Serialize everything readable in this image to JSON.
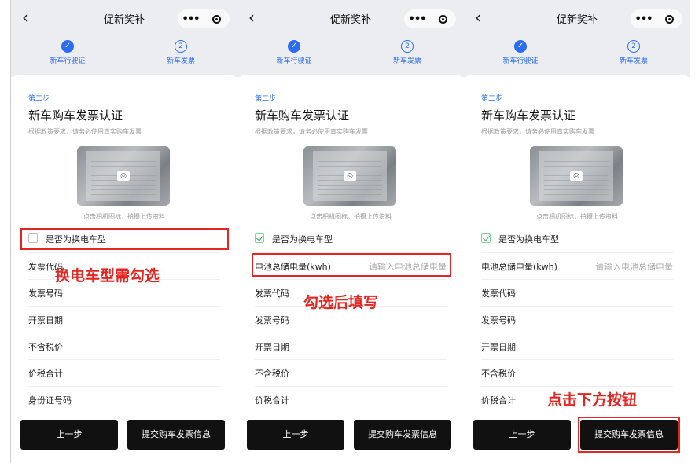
{
  "panels": [
    {
      "back_icon": "‹",
      "title": "促新奖补",
      "more_icon": "•••",
      "steps": {
        "step1_check": "✓",
        "step1_label": "新车行驶证",
        "step2_num": "2",
        "step2_label": "新车发票"
      },
      "step_tag": "第二步",
      "card_title": "新车购车发票认证",
      "card_desc": "根据政策要求，请务必使用真实购车发票",
      "photo_hint": "点击相机图标，拍摄上传资料",
      "checkbox_label": "是否为换电车型",
      "fields": [
        "发票代码",
        "发票号码",
        "开票日期",
        "不含税价",
        "价税合计",
        "身份证号码"
      ],
      "btn_prev": "上一步",
      "btn_submit": "提交购车发票信息",
      "annotation": "换电车型需勾选"
    },
    {
      "back_icon": "‹",
      "title": "促新奖补",
      "more_icon": "•••",
      "steps": {
        "step1_check": "✓",
        "step1_label": "新车行驶证",
        "step2_num": "2",
        "step2_label": "新车发票"
      },
      "step_tag": "第二步",
      "card_title": "新车购车发票认证",
      "card_desc": "根据政策要求，请务必使用真实购车发票",
      "photo_hint": "点击相机图标，拍摄上传资料",
      "checkbox_label": "是否为换电车型",
      "battery_label": "电池总储电量(kwh)",
      "battery_placeholder": "请输入电池总储电量",
      "fields": [
        "发票代码",
        "发票号码",
        "开票日期",
        "不含税价",
        "价税合计"
      ],
      "btn_prev": "上一步",
      "btn_submit": "提交购车发票信息",
      "annotation": "勾选后填写"
    },
    {
      "back_icon": "‹",
      "title": "促新奖补",
      "more_icon": "•••",
      "steps": {
        "step1_check": "✓",
        "step1_label": "新车行驶证",
        "step2_num": "2",
        "step2_label": "新车发票"
      },
      "step_tag": "第二步",
      "card_title": "新车购车发票认证",
      "card_desc": "根据政策要求，请务必使用真实购车发票",
      "photo_hint": "点击相机图标，拍摄上传资料",
      "checkbox_label": "是否为换电车型",
      "battery_label": "电池总储电量(kwh)",
      "battery_placeholder": "请输入电池总储电量",
      "fields": [
        "发票代码",
        "发票号码",
        "开票日期",
        "不含税价",
        "价税合计"
      ],
      "btn_prev": "上一步",
      "btn_submit": "提交购车发票信息",
      "annotation": "点击下方按钮"
    }
  ],
  "colors": {
    "accent": "#2a6df4",
    "annotation_red": "#e52521",
    "button_bg": "#111111",
    "header_bg": "#ecedf1",
    "check_green": "#2ba84a"
  }
}
